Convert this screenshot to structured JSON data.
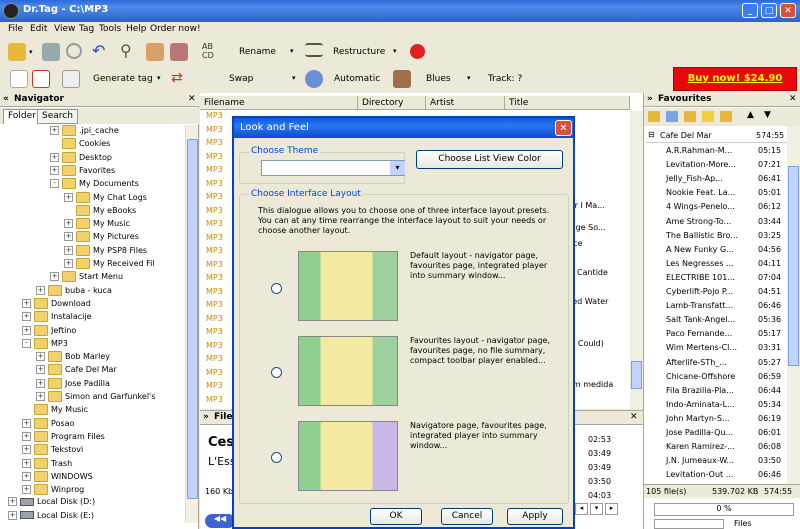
{
  "window": {
    "title": "Dr.Tag - C:\\MP3",
    "minimize": "_",
    "maximize": "□",
    "close": "✕"
  },
  "menu": [
    "File",
    "Edit",
    "View",
    "Tag",
    "Tools",
    "Help",
    "Order now!"
  ],
  "toolbar": {
    "rename": "Rename",
    "restructure": "Restructure",
    "generate_tag": "Generate tag",
    "swap": "Swap",
    "automatic": "Automatic",
    "blues": "Blues",
    "track": "Track: ?",
    "buy_now": "Buy now! $24.90"
  },
  "navigator": {
    "title": "Navigator",
    "tabs": [
      "Folder",
      "Search"
    ],
    "tree": [
      {
        "label": ".jpi_cache",
        "depth": 3,
        "exp": "+"
      },
      {
        "label": "Cookies",
        "depth": 3,
        "exp": ""
      },
      {
        "label": "Desktop",
        "depth": 3,
        "exp": "+"
      },
      {
        "label": "Favorites",
        "depth": 3,
        "exp": "+"
      },
      {
        "label": "My Documents",
        "depth": 3,
        "exp": "-"
      },
      {
        "label": "My Chat Logs",
        "depth": 4,
        "exp": "+"
      },
      {
        "label": "My eBooks",
        "depth": 4,
        "exp": ""
      },
      {
        "label": "My Music",
        "depth": 4,
        "exp": "+"
      },
      {
        "label": "My Pictures",
        "depth": 4,
        "exp": "+"
      },
      {
        "label": "My PSP8 Files",
        "depth": 4,
        "exp": "+"
      },
      {
        "label": "My Received Fil",
        "depth": 4,
        "exp": "+"
      },
      {
        "label": "Start Menu",
        "depth": 3,
        "exp": "+"
      },
      {
        "label": "buba - kuca",
        "depth": 2,
        "exp": "+"
      },
      {
        "label": "Download",
        "depth": 1,
        "exp": "+"
      },
      {
        "label": "Instalacije",
        "depth": 1,
        "exp": "+"
      },
      {
        "label": "Jeftino",
        "depth": 1,
        "exp": "+"
      },
      {
        "label": "MP3",
        "depth": 1,
        "exp": "-"
      },
      {
        "label": "Bob Marley",
        "depth": 2,
        "exp": "+"
      },
      {
        "label": "Cafe Del Mar",
        "depth": 2,
        "exp": "+"
      },
      {
        "label": "Jose Padilla",
        "depth": 2,
        "exp": "+"
      },
      {
        "label": "Simon and Garfunkel's",
        "depth": 2,
        "exp": "+"
      },
      {
        "label": "My Music",
        "depth": 1,
        "exp": ""
      },
      {
        "label": "Posao",
        "depth": 1,
        "exp": "+"
      },
      {
        "label": "Program Files",
        "depth": 1,
        "exp": "+"
      },
      {
        "label": "Tekstovi",
        "depth": 1,
        "exp": "+"
      },
      {
        "label": "Trash",
        "depth": 1,
        "exp": "+"
      },
      {
        "label": "WINDOWS",
        "depth": 1,
        "exp": "+"
      },
      {
        "label": "Winprog",
        "depth": 1,
        "exp": "+"
      },
      {
        "label": "Local Disk (D:)",
        "depth": 0,
        "exp": "+",
        "disk": true
      },
      {
        "label": "Local Disk (E:)",
        "depth": 0,
        "exp": "+",
        "disk": true
      }
    ]
  },
  "filelist": {
    "columns": [
      "Filename",
      "Directory",
      "Artist",
      "Title"
    ],
    "mp3_label": "MP3",
    "visible_titles": [
      "ver I Ma...",
      "ridge So...",
      "nce",
      "Cantide",
      "led Water",
      "I Could)",
      "em medida"
    ],
    "file_panel_title": "File",
    "now_playing_artist": "Cesa",
    "now_playing_album": "L'Ess",
    "bitrate": "160 Kbp",
    "durations": [
      "02:53",
      "03:49",
      "03:49",
      "03:50",
      "04:03"
    ]
  },
  "favourites": {
    "title": "Favourites",
    "album": "Cafe Del Mar",
    "album_time": "574:55",
    "tracks": [
      {
        "name": "A.R.Rahman-M...",
        "time": "05:15"
      },
      {
        "name": "Levitation-More...",
        "time": "07:21"
      },
      {
        "name": "Jelly_Fish-Ap...",
        "time": "06:41"
      },
      {
        "name": "Nookie Feat. La...",
        "time": "05:01"
      },
      {
        "name": "4 Wings-Penelo...",
        "time": "06:12"
      },
      {
        "name": "Ame Strong-To...",
        "time": "03:44"
      },
      {
        "name": "The Ballistic Bro...",
        "time": "03:25"
      },
      {
        "name": "A New Funky G...",
        "time": "04:56"
      },
      {
        "name": "Les Negresses ...",
        "time": "04:11"
      },
      {
        "name": "ELECTRIBE 101...",
        "time": "07:04"
      },
      {
        "name": "Cyberlift-Pojo P...",
        "time": "04:51"
      },
      {
        "name": "Lamb-Transfatt...",
        "time": "06:46"
      },
      {
        "name": "Salt Tank-Angel...",
        "time": "05:36"
      },
      {
        "name": "Paco Fernande...",
        "time": "05:17"
      },
      {
        "name": "Wim Mertens-Cl...",
        "time": "03:31"
      },
      {
        "name": "Afterlife-STh_...",
        "time": "05:27"
      },
      {
        "name": "Chicane-Offshore",
        "time": "06:59"
      },
      {
        "name": "Fila Brazilia-Pla...",
        "time": "06:44"
      },
      {
        "name": "Indo-Aminata-L...",
        "time": "05:34"
      },
      {
        "name": "John Martyn-S...",
        "time": "06:19"
      },
      {
        "name": "Jose Padilla-Qu...",
        "time": "06:01"
      },
      {
        "name": "Karen Ramirez-...",
        "time": "06:08"
      },
      {
        "name": "J.N. Jumeaux-W...",
        "time": "03:50"
      },
      {
        "name": "Levitation-Out ...",
        "time": "06:46"
      }
    ],
    "file_count": "105 file(s)",
    "size": "539.702 KB",
    "total_time": "574:55",
    "progress": "0 %",
    "files_label": "Files"
  },
  "dialog": {
    "title": "Look and Feel",
    "close": "✕",
    "choose_theme_label": "Choose Theme",
    "theme_value": "",
    "list_view_button": "Choose List View Color",
    "layout_group_label": "Choose Interface Layout",
    "intro": "This dialogue allows you to choose one of three interface layout presets. You can at any time rearrange the interface layout to suit your needs or choose another layout.",
    "options": [
      {
        "desc": "Default layout - navigator page, favourites page, integrated player into summary window..."
      },
      {
        "desc": "Favourites layout - navigator page, favourites page, no file summary, compact toolbar player enabled..."
      },
      {
        "desc": "Navigatore page, favourites page, integrated player into summary window..."
      }
    ],
    "ok": "OK",
    "cancel": "Cancel",
    "apply": "Apply"
  }
}
